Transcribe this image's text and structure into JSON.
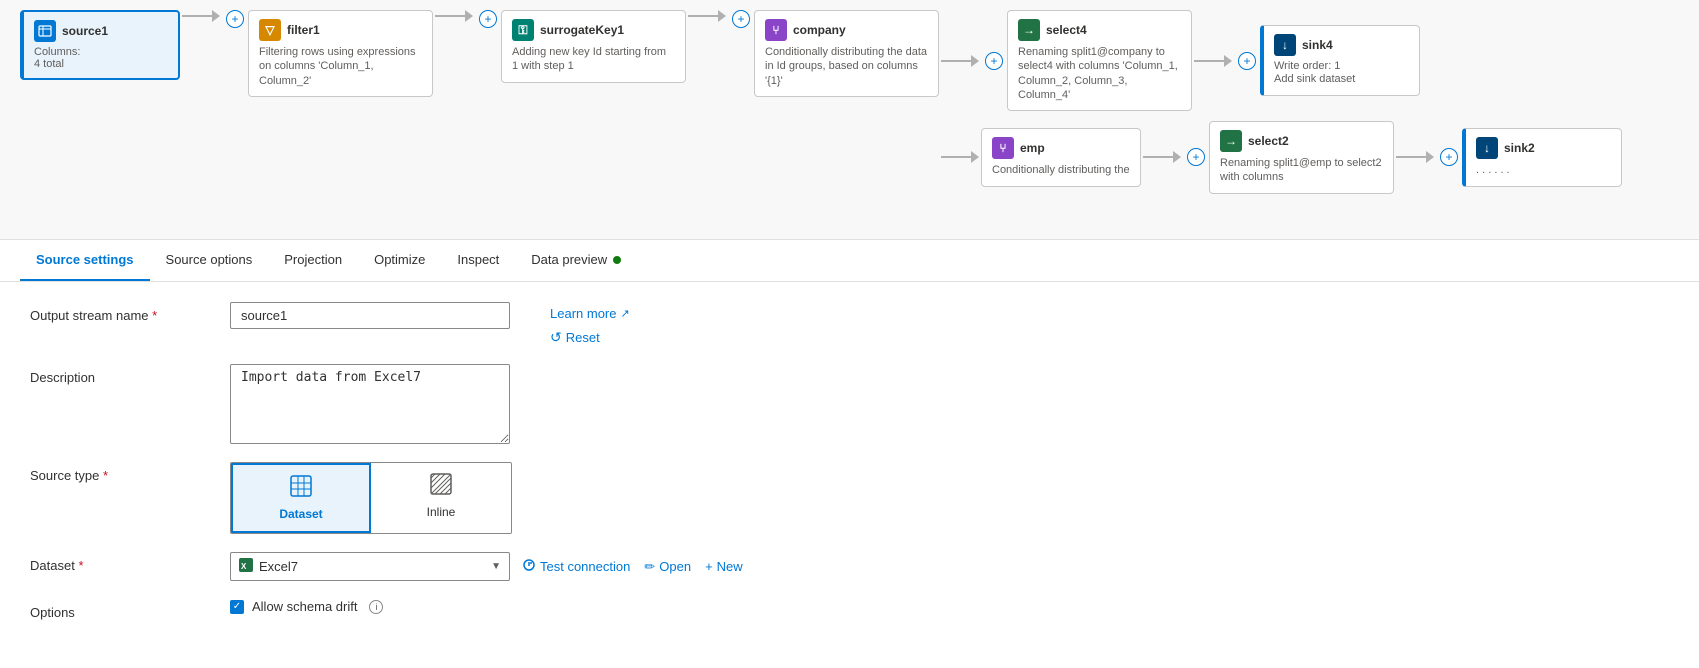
{
  "pipeline": {
    "nodes": [
      {
        "id": "source1",
        "label": "source1",
        "type": "source",
        "icon": "excel",
        "desc_line1": "Columns:",
        "desc_line2": "4 total",
        "selected": true
      },
      {
        "id": "filter1",
        "label": "filter1",
        "type": "filter",
        "icon": "filter",
        "desc": "Filtering rows using expressions on columns 'Column_1, Column_2'"
      },
      {
        "id": "surrogateKey1",
        "label": "surrogateKey1",
        "type": "surrogate",
        "icon": "surrogate",
        "desc": "Adding new key Id starting from 1 with step 1"
      },
      {
        "id": "company",
        "label": "company",
        "type": "branch",
        "icon": "branch",
        "desc": "Conditionally distributing the data in Id groups, based on columns '{1}'"
      },
      {
        "id": "select4",
        "label": "select4",
        "type": "select",
        "icon": "select",
        "desc": "Renaming split1@company to select4 with columns 'Column_1, Column_2, Column_3, Column_4'"
      },
      {
        "id": "sink4",
        "label": "sink4",
        "type": "sink",
        "icon": "sink",
        "write_order": "Write order: 1",
        "desc": "Add sink dataset"
      },
      {
        "id": "emp",
        "label": "emp",
        "type": "branch2",
        "icon": "branch",
        "desc": "Conditionally distributing the"
      },
      {
        "id": "select2",
        "label": "select2",
        "type": "select",
        "icon": "select",
        "desc": "Renaming split1@emp to select2 with columns"
      },
      {
        "id": "sink2",
        "label": "sink2",
        "type": "sink",
        "icon": "sink",
        "desc": ""
      }
    ]
  },
  "tabs": [
    {
      "id": "source-settings",
      "label": "Source settings",
      "active": true,
      "dot": false
    },
    {
      "id": "source-options",
      "label": "Source options",
      "active": false,
      "dot": false
    },
    {
      "id": "projection",
      "label": "Projection",
      "active": false,
      "dot": false
    },
    {
      "id": "optimize",
      "label": "Optimize",
      "active": false,
      "dot": false
    },
    {
      "id": "inspect",
      "label": "Inspect",
      "active": false,
      "dot": false
    },
    {
      "id": "data-preview",
      "label": "Data preview",
      "active": false,
      "dot": true
    }
  ],
  "form": {
    "output_stream_label": "Output stream name",
    "output_stream_required": true,
    "output_stream_value": "source1",
    "description_label": "Description",
    "description_value": "Import data from Excel7",
    "source_type_label": "Source type",
    "source_type_required": true,
    "source_type_options": [
      {
        "id": "dataset",
        "label": "Dataset",
        "active": true
      },
      {
        "id": "inline",
        "label": "Inline",
        "active": false
      }
    ],
    "dataset_label": "Dataset",
    "dataset_required": true,
    "dataset_value": "Excel7",
    "dataset_actions": [
      {
        "id": "test-connection",
        "label": "Test connection",
        "icon": "connection"
      },
      {
        "id": "open",
        "label": "Open",
        "icon": "edit"
      },
      {
        "id": "new",
        "label": "New",
        "icon": "plus"
      }
    ],
    "options_label": "Options",
    "allow_schema_drift_label": "Allow schema drift",
    "allow_schema_drift_checked": true,
    "info_text": "i",
    "learn_more_label": "Learn more",
    "reset_label": "Reset"
  }
}
